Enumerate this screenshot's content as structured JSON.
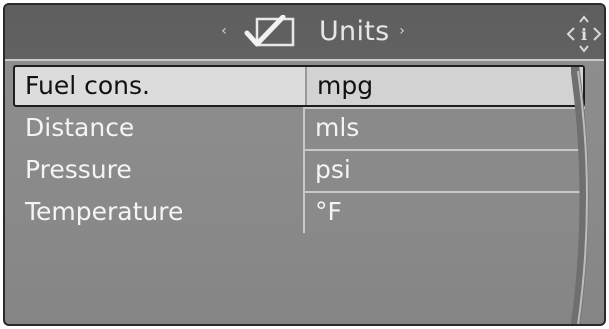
{
  "header": {
    "title": "Units",
    "left_arrow": "‹",
    "right_arrow": "›",
    "check_icon": "checkmark-box-icon",
    "info_icon": "info-icon"
  },
  "settings": [
    {
      "label": "Fuel cons.",
      "value": "mpg",
      "selected": true
    },
    {
      "label": "Distance",
      "value": "mls",
      "selected": false
    },
    {
      "label": "Pressure",
      "value": "psi",
      "selected": false
    },
    {
      "label": "Temperature",
      "value": "°F",
      "selected": false
    }
  ],
  "colors": {
    "background": "#8a8a8a",
    "header": "#606060",
    "selection": "#dcdcdc",
    "text": "#f4f4f4"
  }
}
